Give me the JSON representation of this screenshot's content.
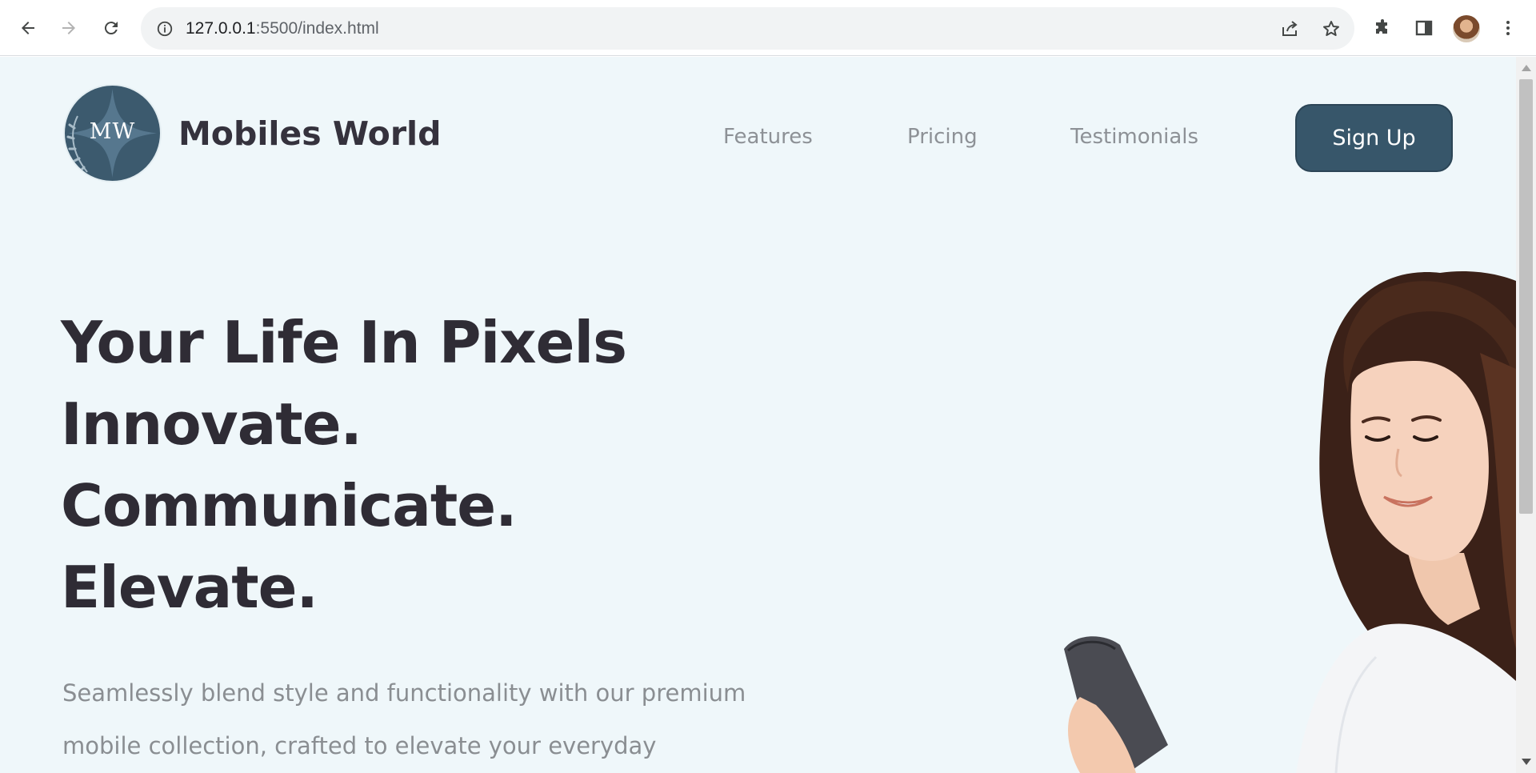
{
  "browser": {
    "url_host": "127.0.0.1",
    "url_path": ":5500/index.html"
  },
  "header": {
    "logo_text": "MW",
    "brand_name": "Mobiles World",
    "nav": [
      {
        "label": "Features"
      },
      {
        "label": "Pricing"
      },
      {
        "label": "Testimonials"
      }
    ],
    "signup_label": "Sign Up"
  },
  "hero": {
    "lines": [
      "Your Life In Pixels",
      "Innovate.",
      "Communicate.",
      "Elevate."
    ],
    "subtitle_lines": [
      "Seamlessly blend style and functionality with our premium",
      "mobile collection, crafted to elevate your everyday"
    ]
  },
  "colors": {
    "page_bg": "#eff7fa",
    "primary": "#37566a",
    "heading": "#2f2c35",
    "muted": "#8a8e92"
  }
}
